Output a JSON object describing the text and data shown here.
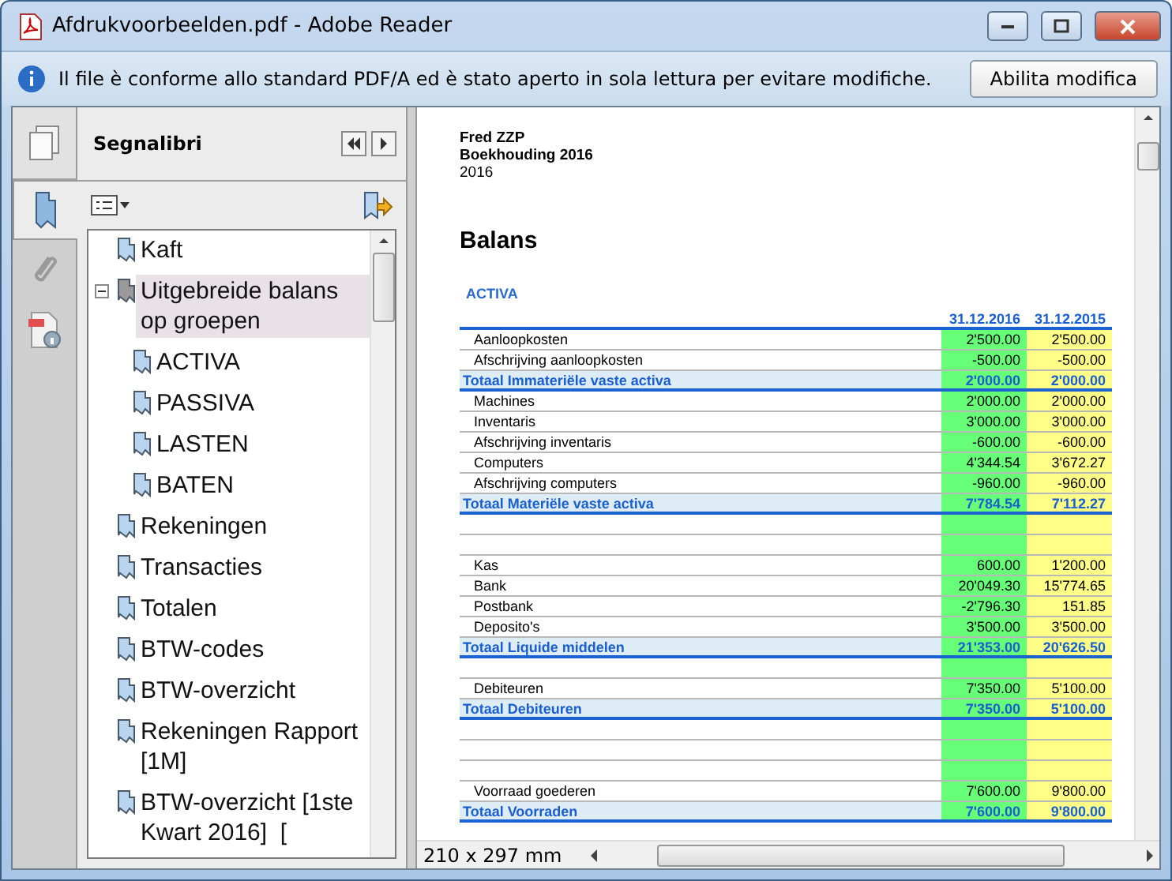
{
  "window": {
    "title": "Afdrukvoorbeelden.pdf - Adobe Reader"
  },
  "info_bar": {
    "message": "Il file è conforme allo standard PDF/A ed è stato aperto in sola lettura per evitare modifiche.",
    "button": "Abilita modifica"
  },
  "nav_tabs": [
    {
      "kind": "pages",
      "selected": false
    },
    {
      "kind": "bookmarks",
      "selected": true
    },
    {
      "kind": "attachments",
      "selected": false
    },
    {
      "kind": "signatures",
      "selected": false
    }
  ],
  "sidebar": {
    "title": "Segnalibri",
    "items": [
      {
        "label": "Kaft",
        "selected": false
      },
      {
        "label": "Uitgebreide balans op groepen",
        "selected": true,
        "expanded": true,
        "children": [
          {
            "label": "ACTIVA",
            "selected": false
          },
          {
            "label": "PASSIVA",
            "selected": false
          },
          {
            "label": "LASTEN",
            "selected": false
          },
          {
            "label": "BATEN",
            "selected": false
          }
        ]
      },
      {
        "label": "Rekeningen",
        "selected": false
      },
      {
        "label": "Transacties",
        "selected": false
      },
      {
        "label": "Totalen",
        "selected": false
      },
      {
        "label": "BTW-codes",
        "selected": false
      },
      {
        "label": "BTW-overzicht",
        "selected": false
      },
      {
        "label": "Rekeningen Rapport [1M]",
        "selected": false
      },
      {
        "label": "BTW-overzicht [1ste Kwart 2016]  [",
        "selected": false
      }
    ]
  },
  "document": {
    "header": [
      "Fred ZZP",
      "Boekhouding 2016",
      "2016"
    ],
    "title": "Balans",
    "section": "ACTIVA",
    "columns": [
      "31.12.2016",
      "31.12.2015"
    ],
    "rows": [
      {
        "kind": "item",
        "label": "Aanloopkosten",
        "values": [
          "2'500.00",
          "2'500.00"
        ]
      },
      {
        "kind": "item",
        "label": "Afschrijving aanloopkosten",
        "values": [
          "-500.00",
          "-500.00"
        ]
      },
      {
        "kind": "total",
        "label": "Totaal Immateriële vaste activa",
        "values": [
          "2'000.00",
          "2'000.00"
        ]
      },
      {
        "kind": "item",
        "label": "Machines",
        "values": [
          "2'000.00",
          "2'000.00"
        ]
      },
      {
        "kind": "item",
        "label": "Inventaris",
        "values": [
          "3'000.00",
          "3'000.00"
        ]
      },
      {
        "kind": "item",
        "label": "Afschrijving inventaris",
        "values": [
          "-600.00",
          "-600.00"
        ]
      },
      {
        "kind": "item",
        "label": "Computers",
        "values": [
          "4'344.54",
          "3'672.27"
        ]
      },
      {
        "kind": "item",
        "label": "Afschrijving computers",
        "values": [
          "-960.00",
          "-960.00"
        ]
      },
      {
        "kind": "total",
        "label": "Totaal Materiële vaste activa",
        "values": [
          "7'784.54",
          "7'112.27"
        ]
      },
      {
        "kind": "blank"
      },
      {
        "kind": "blank"
      },
      {
        "kind": "item",
        "label": "Kas",
        "values": [
          "600.00",
          "1'200.00"
        ]
      },
      {
        "kind": "item",
        "label": "Bank",
        "values": [
          "20'049.30",
          "15'774.65"
        ]
      },
      {
        "kind": "item",
        "label": "Postbank",
        "values": [
          "-2'796.30",
          "151.85"
        ]
      },
      {
        "kind": "item",
        "label": "Deposito's",
        "values": [
          "3'500.00",
          "3'500.00"
        ]
      },
      {
        "kind": "total",
        "label": "Totaal Liquide middelen",
        "values": [
          "21'353.00",
          "20'626.50"
        ]
      },
      {
        "kind": "blank"
      },
      {
        "kind": "item",
        "label": "Debiteuren",
        "values": [
          "7'350.00",
          "5'100.00"
        ]
      },
      {
        "kind": "total",
        "label": "Totaal Debiteuren",
        "values": [
          "7'350.00",
          "5'100.00"
        ]
      },
      {
        "kind": "blank"
      },
      {
        "kind": "blank"
      },
      {
        "kind": "blank"
      },
      {
        "kind": "item",
        "label": "Voorraad goederen",
        "values": [
          "7'600.00",
          "9'800.00"
        ]
      },
      {
        "kind": "total",
        "label": "Totaal Voorraden",
        "values": [
          "7'600.00",
          "9'800.00"
        ]
      }
    ]
  },
  "status_bar": {
    "page_size": "210 x 297 mm"
  }
}
